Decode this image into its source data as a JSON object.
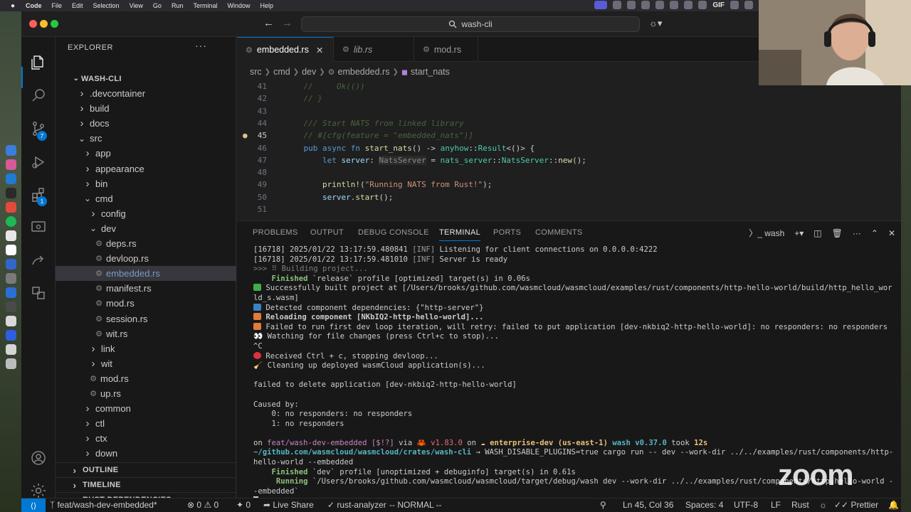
{
  "menubar": {
    "app": "Code",
    "items": [
      "File",
      "Edit",
      "Selection",
      "View",
      "Go",
      "Run",
      "Terminal",
      "Window",
      "Help"
    ],
    "tray_text": "GIF"
  },
  "titlebar": {
    "search_text": "wash-cli"
  },
  "explorer": {
    "header": "EXPLORER",
    "root": "WASH-CLI",
    "items": [
      {
        "label": ".devcontainer",
        "kind": "folder",
        "open": false
      },
      {
        "label": "build",
        "kind": "folder",
        "open": false
      },
      {
        "label": "docs",
        "kind": "folder",
        "open": false
      },
      {
        "label": "src",
        "kind": "folder",
        "open": true
      },
      {
        "label": "app",
        "kind": "folder",
        "open": false
      },
      {
        "label": "appearance",
        "kind": "folder",
        "open": false
      },
      {
        "label": "bin",
        "kind": "folder",
        "open": false
      },
      {
        "label": "cmd",
        "kind": "folder",
        "open": true
      },
      {
        "label": "config",
        "kind": "folder",
        "open": false
      },
      {
        "label": "dev",
        "kind": "folder",
        "open": true
      },
      {
        "label": "deps.rs",
        "kind": "file"
      },
      {
        "label": "devloop.rs",
        "kind": "file"
      },
      {
        "label": "embedded.rs",
        "kind": "file",
        "selected": true
      },
      {
        "label": "manifest.rs",
        "kind": "file"
      },
      {
        "label": "mod.rs",
        "kind": "file"
      },
      {
        "label": "session.rs",
        "kind": "file"
      },
      {
        "label": "wit.rs",
        "kind": "file"
      },
      {
        "label": "link",
        "kind": "folder",
        "open": false
      },
      {
        "label": "wit",
        "kind": "folder",
        "open": false
      },
      {
        "label": "mod.rs",
        "kind": "file"
      },
      {
        "label": "up.rs",
        "kind": "file"
      },
      {
        "label": "common",
        "kind": "folder",
        "open": false
      },
      {
        "label": "ctl",
        "kind": "folder",
        "open": false
      },
      {
        "label": "ctx",
        "kind": "folder",
        "open": false
      },
      {
        "label": "down",
        "kind": "folder",
        "open": false
      }
    ],
    "sections": [
      "OUTLINE",
      "TIMELINE",
      "RUST DEPENDENCIES"
    ]
  },
  "activity": {
    "scm_badge": "7",
    "extensions_badge": "1"
  },
  "tabs": [
    {
      "label": "embedded.rs",
      "active": true
    },
    {
      "label": "lib.rs",
      "active": false
    },
    {
      "label": "mod.rs",
      "active": false
    }
  ],
  "breadcrumb": [
    "src",
    "cmd",
    "dev",
    "embedded.rs",
    "start_nats"
  ],
  "code_lines": [
    {
      "n": "41",
      "parts": [
        {
          "t": "    //     Ok(())",
          "c": "c-com"
        }
      ]
    },
    {
      "n": "42",
      "parts": [
        {
          "t": "    // }",
          "c": "c-com"
        }
      ]
    },
    {
      "n": "43",
      "parts": []
    },
    {
      "n": "44",
      "parts": [
        {
          "t": "    /// Start NATS from linked library",
          "c": "c-com"
        }
      ]
    },
    {
      "n": "45",
      "parts": [
        {
          "t": "    // #[cfg(feature = \"embedded_nats\")]",
          "c": "c-com"
        }
      ]
    },
    {
      "n": "46",
      "parts": [
        {
          "t": "    pub async fn ",
          "c": "c-kw"
        },
        {
          "t": "start_nats",
          "c": "c-fn"
        },
        {
          "t": "() -> ",
          "c": ""
        },
        {
          "t": "anyhow",
          "c": "c-ty"
        },
        {
          "t": "::",
          "c": ""
        },
        {
          "t": "Result",
          "c": "c-ty"
        },
        {
          "t": "<()> {",
          "c": ""
        }
      ]
    },
    {
      "n": "47",
      "parts": [
        {
          "t": "        let ",
          "c": "c-kw"
        },
        {
          "t": "server",
          "c": "c-var"
        },
        {
          "t": ": ",
          "c": ""
        },
        {
          "t": "NatsServer",
          "c": "c-hint"
        },
        {
          "t": " = ",
          "c": ""
        },
        {
          "t": "nats_server",
          "c": "c-ty"
        },
        {
          "t": "::",
          "c": ""
        },
        {
          "t": "NatsServer",
          "c": "c-ty"
        },
        {
          "t": "::",
          "c": ""
        },
        {
          "t": "new",
          "c": "c-fn"
        },
        {
          "t": "();",
          "c": ""
        }
      ]
    },
    {
      "n": "48",
      "parts": []
    },
    {
      "n": "49",
      "parts": [
        {
          "t": "        println!",
          "c": "c-fn"
        },
        {
          "t": "(",
          "c": ""
        },
        {
          "t": "\"Running NATS from Rust!\"",
          "c": "c-str"
        },
        {
          "t": ");",
          "c": ""
        }
      ]
    },
    {
      "n": "50",
      "parts": [
        {
          "t": "        server",
          "c": "c-var"
        },
        {
          "t": ".",
          "c": ""
        },
        {
          "t": "start",
          "c": "c-fn"
        },
        {
          "t": "();",
          "c": ""
        }
      ]
    },
    {
      "n": "51",
      "parts": []
    }
  ],
  "current_line": "45",
  "panel": {
    "tabs": [
      "PROBLEMS",
      "OUTPUT",
      "DEBUG CONSOLE",
      "TERMINAL",
      "PORTS",
      "COMMENTS"
    ],
    "active_tab": "TERMINAL",
    "terminal_name": "wash"
  },
  "terminal_lines": [
    [
      {
        "t": "[16718] 2025/01/22 13:17:59.480841 ",
        "c": ""
      },
      {
        "t": "[INF]",
        "c": "t-inf"
      },
      {
        "t": " Listening for client connections on 0.0.0.0:4222",
        "c": ""
      }
    ],
    [
      {
        "t": "[16718] 2025/01/22 13:17:59.481010 ",
        "c": ""
      },
      {
        "t": "[INF]",
        "c": "t-inf"
      },
      {
        "t": " Server is ready",
        "c": ""
      }
    ],
    [
      {
        "t": ">>> ⠿ Building project...",
        "c": "t-dim"
      }
    ],
    [
      {
        "t": "    Finished ",
        "c": "t-green"
      },
      {
        "t": "`release` profile [optimized] target(s) in 0.06s",
        "c": ""
      }
    ],
    [
      {
        "e": "#3fae49"
      },
      {
        "t": " Successfully built project at [/Users/brooks/github.com/wasmcloud/wasmcloud/examples/rust/components/http-hello-world/build/http_hello_wor",
        "c": ""
      }
    ],
    [
      {
        "t": "ld_s.wasm]",
        "c": ""
      }
    ],
    [
      {
        "e": "#3b82c4"
      },
      {
        "t": " Detected component dependencies: {\"http-server\"}",
        "c": ""
      }
    ],
    [
      {
        "e": "#e07b39"
      },
      {
        "t": " Reloading component [NKbIQ2-http-hello-world]...",
        "c": "t-bold"
      }
    ],
    [
      {
        "e": "#e07b39"
      },
      {
        "t": " Failed to run first dev loop iteration, will retry: failed to put application [dev-nkbiq2-http-hello-world]: no responders: no responders",
        "c": ""
      }
    ],
    [
      {
        "t": "👀 Watching for file changes (press Ctrl+c to stop)...",
        "c": ""
      }
    ],
    [
      {
        "t": "^C",
        "c": ""
      }
    ],
    [
      {
        "e": "#d9333f",
        "round": true
      },
      {
        "t": " Received Ctrl + c, stopping devloop...",
        "c": ""
      }
    ],
    [
      {
        "t": "🧹 Cleaning up deployed wasmCloud application(s)...",
        "c": ""
      }
    ],
    [
      {
        "t": "",
        "c": ""
      }
    ],
    [
      {
        "t": "failed to delete application [dev-nkbiq2-http-hello-world]",
        "c": ""
      }
    ],
    [
      {
        "t": "",
        "c": ""
      }
    ],
    [
      {
        "t": "Caused by:",
        "c": ""
      }
    ],
    [
      {
        "t": "    0: no responders: no responders",
        "c": ""
      }
    ],
    [
      {
        "t": "    1: no responders",
        "c": ""
      }
    ],
    [
      {
        "t": "",
        "c": ""
      }
    ],
    [
      {
        "t": "on ",
        "c": ""
      },
      {
        "t": "feat/wash-dev-embedded [$!?]",
        "c": "t-purple"
      },
      {
        "t": " via ",
        "c": ""
      },
      {
        "t": "🦀 v1.83.0",
        "c": "t-red"
      },
      {
        "t": " on ",
        "c": ""
      },
      {
        "t": "☁ enterprise-dev (us-east-1)",
        "c": "t-yellow"
      },
      {
        "t": " ",
        "c": ""
      },
      {
        "t": "wash v0.37.0",
        "c": "t-cyan"
      },
      {
        "t": " took ",
        "c": ""
      },
      {
        "t": "12s",
        "c": "t-yellow"
      }
    ],
    [
      {
        "t": "~/github.com/wasmcloud/wasmcloud/crates/wash-cli",
        "c": "t-cyan"
      },
      {
        "t": " → WASH_DISABLE_PLUGINS=true cargo run -- dev --work-dir ../../examples/rust/components/http-",
        "c": ""
      }
    ],
    [
      {
        "t": "hello-world --embedded",
        "c": ""
      }
    ],
    [
      {
        "t": "    Finished ",
        "c": "t-green"
      },
      {
        "t": "`dev` profile [unoptimized + debuginfo] target(s) in 0.61s",
        "c": ""
      }
    ],
    [
      {
        "t": "     Running ",
        "c": "t-green"
      },
      {
        "t": "`/Users/brooks/github.com/wasmcloud/wasmcloud/target/debug/wash dev --work-dir ../../examples/rust/components/http-hello-world -",
        "c": ""
      }
    ],
    [
      {
        "t": "-embedded`",
        "c": ""
      }
    ]
  ],
  "statusbar": {
    "branch": "feat/wash-dev-embedded*",
    "errors": "0",
    "warnings": "0",
    "ports": "0",
    "live_share": "Live Share",
    "analyzer": "rust-analyzer",
    "vim_mode": "-- NORMAL --",
    "position": "Ln 45, Col 36",
    "spaces": "Spaces: 4",
    "encoding": "UTF-8",
    "eol": "LF",
    "language": "Rust",
    "prettier": "Prettier"
  },
  "overlay": {
    "zoom_logo": "zoom"
  },
  "colors": {
    "accent": "#0078d4",
    "editor_bg": "#1f1f1f",
    "panel_bg": "#181818"
  }
}
